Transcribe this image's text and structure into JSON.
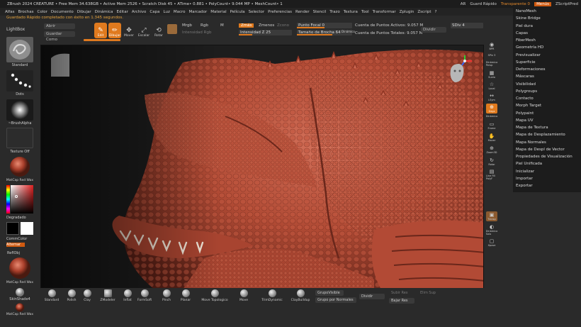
{
  "titlebar": {
    "title": "ZBrush 2024    CREATURE    • Free Mem 34.638GB • Active Mem 2526 • Scratch Disk 45 •  ATime• 0.881 • PolyCount• 9.044 MP  • MeshCount• 1",
    "ar": "AR",
    "quicksave": "Guard Rápido",
    "transparency": "Transparente 0",
    "menus": "Menús",
    "script": "ZScriptPred"
  },
  "menubar": {
    "items": [
      "Alfas",
      "Brochas",
      "Color",
      "Documento",
      "Dibujar",
      "Dinámica",
      "Editar",
      "Archivo",
      "Capa",
      "Luz",
      "Macro",
      "Marcador",
      "Material",
      "Película",
      "Selector",
      "Preferencias",
      "Render",
      "Stencil",
      "Trazo",
      "Textura",
      "Tool",
      "Transformar",
      "Zplugin",
      "Zscript",
      "?"
    ]
  },
  "status": "Guardado Rápido completado con éxito en 1.345 segundos.",
  "toolbar": {
    "lightbox": "LightBox",
    "open": "Abrir",
    "saveas": "Guardar Como",
    "edit": "Edit",
    "draw": "Dibujar",
    "move": "Mover",
    "scale": "Escalar",
    "rotate": "Rotar",
    "mrgb": "Mrgb",
    "rgb": "Rgb",
    "m": "M",
    "rgb_intensity": "Intensidad Rgb",
    "zadd": "Zmás",
    "zsub": "Zmenos",
    "zcut": "Zcono",
    "z_intensity": "Intensidad Z 25",
    "focal": "Punto Focal 0",
    "brush_size": "Tamaño de Brocha 64",
    "dynamic": "Dinámico",
    "active_points": "Cuenta de Puntos Activos: 9.057 M",
    "total_points": "Cuenta de Puntos Totales: 9.057 M",
    "divide": "Dividir",
    "sdiv": "SDiv 4"
  },
  "leftpanel": {
    "brush_name": "Standard",
    "stroke_name": "Dots",
    "alpha_name": "~BrushAlpha",
    "texture_name": "Texture Off",
    "material_name": "MatCap Red Wax",
    "gradient": "Degradado",
    "commcolor": "CommColor",
    "alternate": "Alternar",
    "refl": "ReflObj",
    "material2": "MatCap Red Wax",
    "skin": "SkinShade4",
    "material3": "MatCap Red Wax"
  },
  "rightstrip": [
    {
      "label": "BPR",
      "glyph": "◉",
      "active": false
    },
    {
      "label": "SPix 3",
      "glyph": "",
      "active": false
    },
    {
      "label": "Dinámico Persp",
      "glyph": "",
      "active": false
    },
    {
      "label": "Suelo",
      "glyph": "▦",
      "active": false
    },
    {
      "label": "Local",
      "glyph": "☆",
      "active": false
    },
    {
      "label": "LSym",
      "glyph": "↔",
      "active": false
    },
    {
      "label": "Gxyz",
      "glyph": "",
      "active": true
    },
    {
      "label": "Dinámico",
      "glyph": "",
      "active": false
    },
    {
      "label": "Frame",
      "glyph": "▭",
      "active": false
    },
    {
      "label": "Mover",
      "glyph": "✋",
      "active": false
    },
    {
      "label": "Zoom3D",
      "glyph": "⊕",
      "active": false
    },
    {
      "label": "Rotar",
      "glyph": "↻",
      "active": false
    },
    {
      "label": "Line Fill PolyF",
      "glyph": "▤",
      "active": false
    },
    {
      "label": "Transp",
      "glyph": "▣",
      "active": false
    },
    {
      "label": "Dinámico Solo",
      "glyph": "◐",
      "active": false
    },
    {
      "label": "Xpose",
      "glyph": "▢",
      "active": false
    }
  ],
  "rightmenu": {
    "items": [
      "NanoMesh",
      "Skine Bridge",
      "Piel dura",
      "Capas",
      "FiberMesh",
      "Geometría HD",
      "Previsualizar",
      "Superficie",
      "Deformaciones",
      "Máscaras",
      "Visibilidad",
      "Polygroups",
      "Contacto",
      "Morph Target",
      "Polypaint",
      "Mapa UV",
      "Mapa de Textura",
      "Mapa de Desplazamiento",
      "Mapa Normales",
      "Mapa de Despl de Vector",
      "Propiedades de Visualización",
      "Piel Unificada",
      "Inicializar",
      "Importar",
      "Exportar"
    ]
  },
  "bottombar": {
    "brushes": [
      "Standard",
      "Polish",
      "Clay",
      "ZModeler",
      "Inflat",
      "FormSoft",
      "Pinch",
      "Planar",
      "Move Topologico",
      "Move",
      "TrimDynamic",
      "ClayBuildup"
    ],
    "groups_visible": "GrupoVisible",
    "groups_by_normals": "Grupo por Normales",
    "divide": "Dividir",
    "subdiv_up": "Subir Res",
    "subdiv_del": "Elim Sup",
    "subdiv_down": "Bajar Res"
  },
  "colors": {
    "accent": "#e07a1e",
    "skin": "#b24a35",
    "status_text": "#e4a13b"
  }
}
